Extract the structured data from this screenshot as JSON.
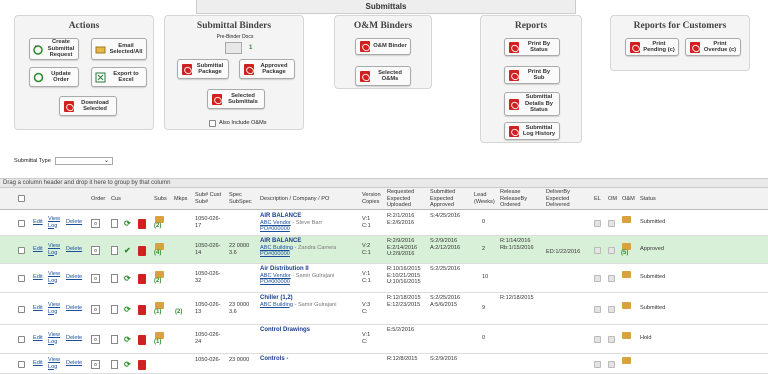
{
  "header": {
    "title": "Submittals"
  },
  "actions": {
    "title": "Actions",
    "create": "Create Submittal Request",
    "email": "Email Selected/All",
    "update": "Update Order",
    "export": "Export to Excel",
    "download": "Download Selected"
  },
  "binders": {
    "title": "Submittal Binders",
    "prebinder": "Pre-Binder Docs",
    "prebinder_count": "1",
    "package": "Submittal Package",
    "approved": "Approved Package",
    "selected": "Selected Submittals",
    "also": "Also Include O&Ms"
  },
  "om": {
    "title": "O&M Binders",
    "binder": "O&M Binder",
    "selected": "Selected O&Ms"
  },
  "reports": {
    "title": "Reports",
    "status": "Print By Status",
    "sub": "Print By Sub",
    "details": "Submittal Details By Status",
    "log": "Submittal Log History"
  },
  "customers": {
    "title": "Reports for Customers",
    "pending": "Print Pending (c)",
    "overdue": "Print Overdue (c)"
  },
  "filter": {
    "label": "Submittal Type",
    "value": ""
  },
  "group_hint": "Drag a column header and drop it here to group by that column",
  "columns": {
    "order": "Order",
    "cus": "Cus",
    "subs": "Subs",
    "mkps": "Mkps",
    "sub": "Sub# Cust Sub#",
    "spec": "Spec SubSpec",
    "desc": "Description / Company / PO",
    "version": "Version Copies",
    "req": "Requested Expected Uploaded",
    "submitted": "Submitted Expected Approved",
    "lead": "Lead (Weeks)",
    "release": "Release ReleaseBy Ordered",
    "deliver": "DeliverBy Expected Delivered",
    "el": "EL",
    "om": "OM",
    "oam": "O&M",
    "status": "Status"
  },
  "row_actions": {
    "edit": "Edit",
    "view": "View Log",
    "delete": "Delete"
  },
  "rows": [
    {
      "order": "0",
      "subs": "(2)",
      "mkps": "",
      "sub": "1050-026-17",
      "spec": "",
      "title": "AIR BALANCE",
      "company": "ABC Vendor",
      "person": "Steve Barr",
      "po": "PO#000000",
      "version": "V:1 C:1",
      "req": "R:2/1/2016 E:2/6/2016",
      "submitted": "S:4/25/2016",
      "lead": "0",
      "release": "",
      "deliver": "",
      "om_count": "",
      "status": "Submitted"
    },
    {
      "order": "0",
      "subs": "(4)",
      "mkps": "",
      "sub": "1050-026-14",
      "spec": "22 0000 3.6",
      "title": "AIR BALANCE",
      "company": "ABC Building",
      "person": "Zandra Carrera",
      "po": "PO#000000",
      "version": "V:2 C:1",
      "req": "R:2/9/2016 E:2/14/2016 U:2/9/2016",
      "submitted": "S:2/9/2016 A:2/12/2016",
      "lead": "2",
      "release": "R:1/14/2016 Rb:1/15/2016",
      "deliver": "ED:1/22/2016",
      "om_count": "(5)",
      "status": "Approved"
    },
    {
      "order": "0",
      "subs": "(2)",
      "mkps": "",
      "sub": "1050-026-32",
      "spec": "",
      "title": "Air Distribution II",
      "company": "ABC Vendor",
      "person": "Samir Gulrajani",
      "po": "PO#000000",
      "version": "V:1 C:1",
      "req": "R:10/16/2015 E:10/21/2015 U:10/16/2015",
      "submitted": "S:2/25/2016",
      "lead": "10",
      "release": "",
      "deliver": "",
      "om_count": "",
      "status": "Submitted"
    },
    {
      "order": "0",
      "subs": "(1)",
      "mkps": "(2)",
      "sub": "1050-026-13",
      "spec": "23 0000 3.6",
      "title": "Chiller (1,2)",
      "company": "ABC Building",
      "person": "Samir Gulrajani",
      "po": "",
      "version": "V:3 C:",
      "req": "R:12/18/2015 E:12/23/2015",
      "submitted": "S:2/25/2016 A:5/6/2015",
      "lead": "9",
      "release": "R:12/18/2015",
      "deliver": "",
      "om_count": "",
      "status": "Submitted"
    },
    {
      "order": "0",
      "subs": "(1)",
      "mkps": "",
      "sub": "1050-026-24",
      "spec": "",
      "title": "Control Drawings",
      "company": "",
      "person": "",
      "po": "",
      "version": "V:1 C:",
      "req": "E:5/2/2016",
      "submitted": "",
      "lead": "0",
      "release": "",
      "deliver": "",
      "om_count": "",
      "status": "Hold"
    },
    {
      "order": "0",
      "subs": "",
      "mkps": "",
      "sub": "1050-026-",
      "spec": "23 0000",
      "title": "Controls -",
      "company": "",
      "person": "",
      "po": "",
      "version": "",
      "req": "R:12/8/2015",
      "submitted": "S:2/9/2016",
      "lead": "",
      "release": "",
      "deliver": "",
      "om_count": "",
      "status": ""
    }
  ]
}
